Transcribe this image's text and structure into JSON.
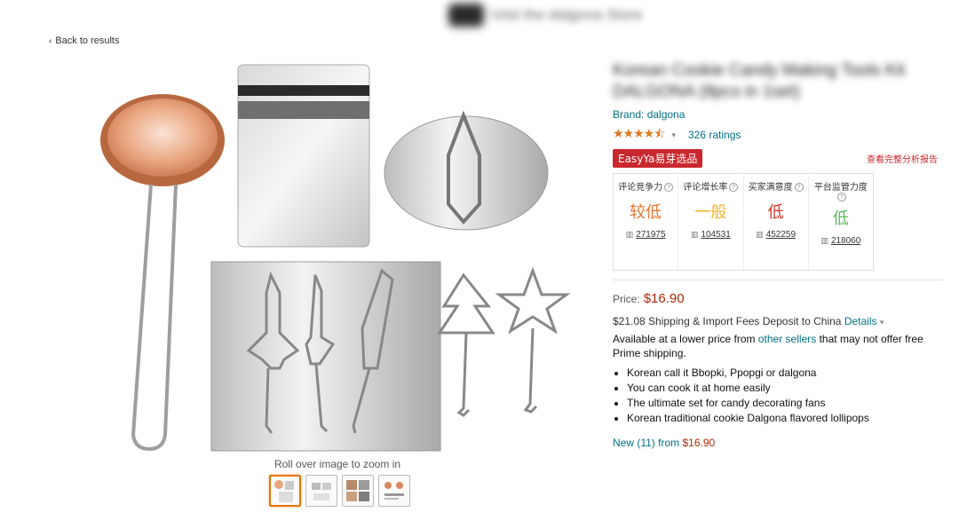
{
  "header": {
    "blurred_store_text": "Visit the dalgona Store"
  },
  "nav": {
    "back_label": "Back to results"
  },
  "gallery": {
    "zoom_hint": "Roll over image to zoom in",
    "thumb_count": 4
  },
  "product": {
    "title_blurred": "Korean Cookie Candy Making Tools Kit DALGONA (8pcs in 1set)",
    "brand": "Brand: dalgona",
    "stars": "★★★★⯪",
    "rating_value": 4.5,
    "ratings_count": "326 ratings"
  },
  "easyya": {
    "badge": "EasyYa易芽选品",
    "report_link": "查看完整分析报告",
    "metrics": [
      {
        "label": "评论竞争力",
        "value": "较低",
        "count": "271975",
        "color": "#e8742c"
      },
      {
        "label": "评论增长率",
        "value": "一般",
        "count": "104531",
        "color": "#f0b429"
      },
      {
        "label": "买家满意度",
        "value": "低",
        "count": "452259",
        "color": "#d9322b"
      },
      {
        "label": "平台监管力度",
        "value": "低",
        "count": "218060",
        "color": "#5cb85c"
      }
    ]
  },
  "pricing": {
    "price_label": "Price:",
    "price": "$16.90",
    "shipping_text": "$21.08 Shipping & Import Fees Deposit to China",
    "shipping_details": "Details",
    "avail_prefix": "Available at a lower price from",
    "avail_link": "other sellers",
    "avail_suffix": "that may not offer free Prime shipping."
  },
  "bullets": [
    "Korean call it Bbopki, Ppopgi or dalgona",
    "You can cook it at home easily",
    "The ultimate set for candy decorating fans",
    "Korean traditional cookie Dalgona flavored lollipops"
  ],
  "offers": {
    "new_label": "New (11) from",
    "new_price": "$16.90"
  },
  "colors": {
    "link": "#007185",
    "price": "#b12704",
    "star": "#de7921",
    "easyya_red": "#c8282e"
  }
}
